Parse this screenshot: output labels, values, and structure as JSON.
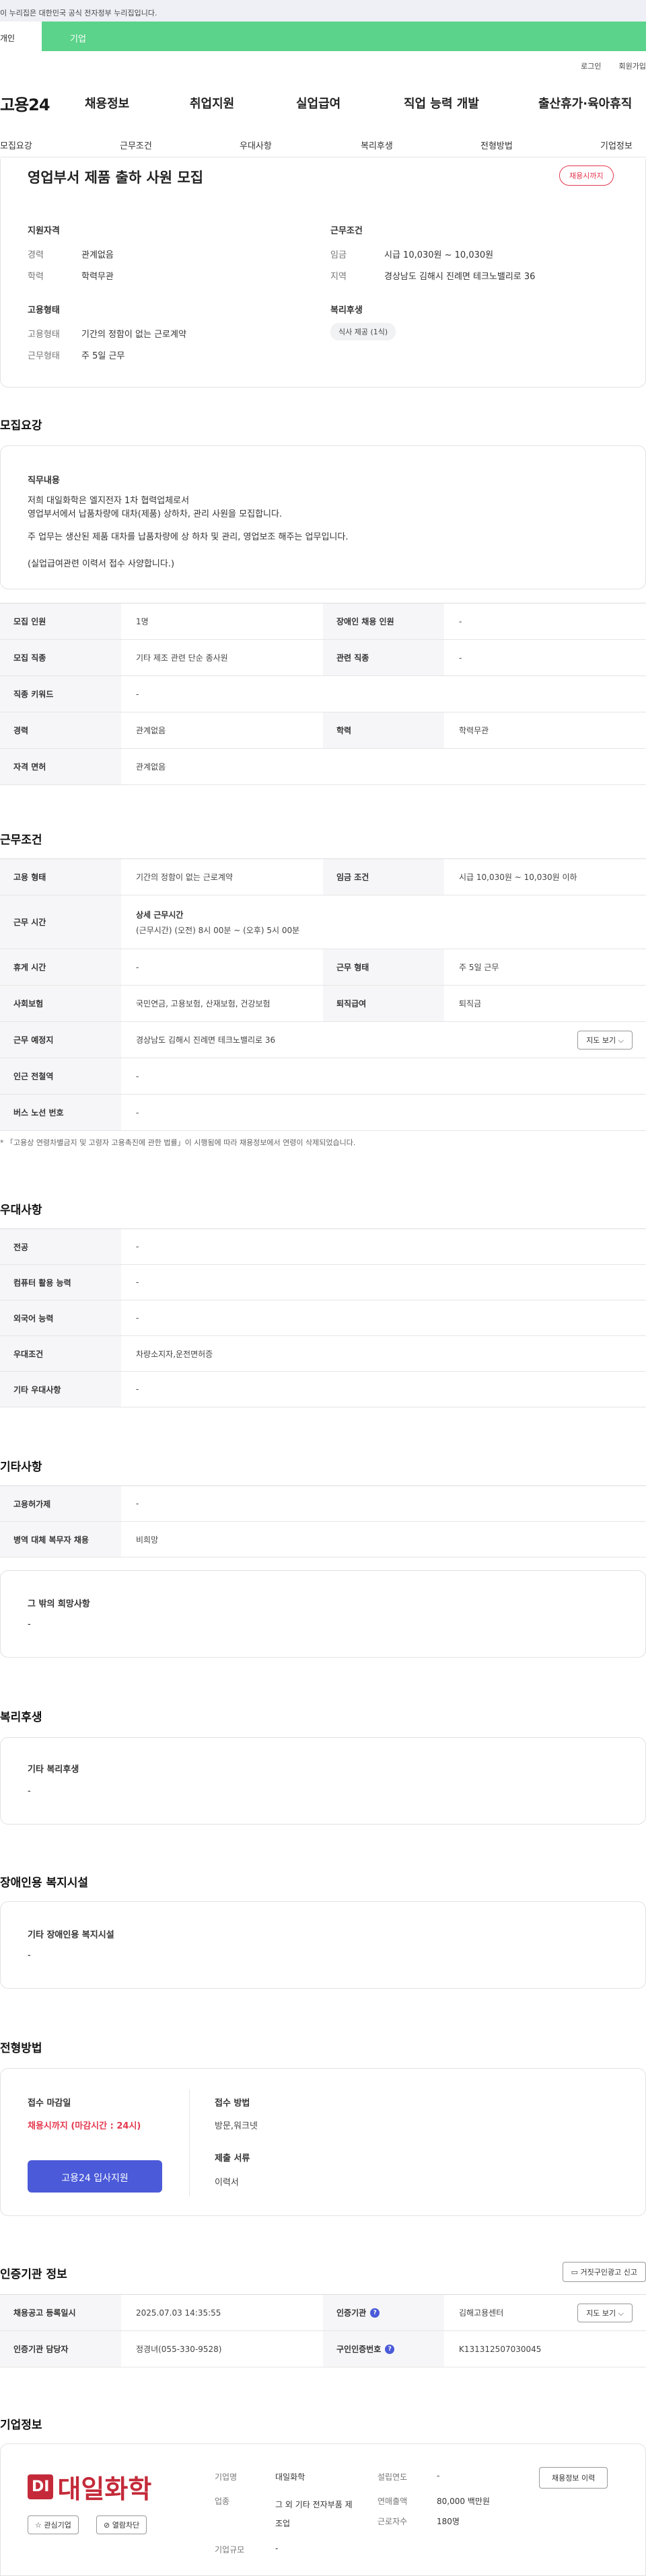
{
  "gov_banner": "이 누리집은 대한민국 공식 전자정부 누리집입니다.",
  "tabs": {
    "individual": "개인",
    "business": "기업"
  },
  "util": {
    "login": "로그인",
    "signup": "회원가입"
  },
  "gnb": {
    "logo": "고용24",
    "items": [
      "채용정보",
      "취업지원",
      "실업급여",
      "직업 능력 개발",
      "출산휴가·육아휴직"
    ]
  },
  "anchors": [
    "모집요강",
    "근무조건",
    "우대사항",
    "복리후생",
    "전형방법",
    "기업정보"
  ],
  "summary": {
    "title": "영업부서 제품 출하 사원 모집",
    "status": "채용시까지",
    "qual_title": "지원자격",
    "qual": [
      {
        "k": "경력",
        "v": "관계없음"
      },
      {
        "k": "학력",
        "v": "학력무관"
      }
    ],
    "cond_title": "근무조건",
    "cond": [
      {
        "k": "임금",
        "v": "시급 10,030원 ~ 10,030원"
      },
      {
        "k": "지역",
        "v": "경상남도 김해시 진례면 테크노밸리로 36"
      }
    ],
    "emp_title": "고용형태",
    "emp": [
      {
        "k": "고용형태",
        "v": "기간의 정함이 없는 근로계약"
      },
      {
        "k": "근무형태",
        "v": "주 5일 근무"
      }
    ],
    "welfare_title": "복리후생",
    "welfare_tag": "식사 제공 (1식)"
  },
  "recruit": {
    "heading": "모집요강",
    "job_title": "직무내용",
    "job_lines": [
      "저희 대일화학은 엘지전자 1차 협력업체로서",
      "영업부서에서 납품차량에 대차(제품) 상하차, 관리 사원을 모집합니다.",
      "주 업무는 생산된 제품 대차를 납품차량에 상 하차 및 관리, 영업보조 해주는 업무입니다.",
      "(실업급여관련 이력서 접수 사양합니다.)"
    ],
    "rows": [
      {
        "a": "모집 인원",
        "b": "1명",
        "c": "장애인 채용 인원",
        "d": "-"
      },
      {
        "a": "모집 직종",
        "b": "기타 제조 관련 단순 종사원",
        "c": "관련 직종",
        "d": "-"
      },
      {
        "a": "직종 키워드",
        "b": "-"
      },
      {
        "a": "경력",
        "b": "관계없음",
        "c": "학력",
        "d": "학력무관"
      },
      {
        "a": "자격 면허",
        "b": "관계없음"
      }
    ]
  },
  "work": {
    "heading": "근무조건",
    "r1": {
      "a": "고용 형태",
      "b": "기간의 정함이 없는 근로계약",
      "c": "임금 조건",
      "d": "시급 10,030원 ~ 10,030원 이하"
    },
    "r2": {
      "a": "근무 시간",
      "b1": "상세 근무시간",
      "b2": "(근무시간) (오전) 8시 00분 ~ (오후) 5시 00분"
    },
    "r3": {
      "a": "휴게 시간",
      "b": "-",
      "c": "근무 형태",
      "d": "주 5일 근무"
    },
    "r4": {
      "a": "사회보험",
      "b": "국민연금, 고용보험, 산재보험, 건강보험",
      "c": "퇴직급여",
      "d": "퇴직금"
    },
    "r5": {
      "a": "근무 예정지",
      "b": "경상남도 김해시 진례면 테크노밸리로 36",
      "btn": "지도 보기 ⌵"
    },
    "r6": {
      "a": "인근 전철역",
      "b": "-"
    },
    "r7": {
      "a": "버스 노선 번호",
      "b": "-"
    },
    "note": "* 「고용상 연령차별금지 및 고령자 고용촉진에 관한 법률」이 시행됨에 따라 채용정보에서 연령이 삭제되었습니다."
  },
  "pref": {
    "heading": "우대사항",
    "rows": [
      {
        "a": "전공",
        "b": "-"
      },
      {
        "a": "컴퓨터 활용 능력",
        "b": "-"
      },
      {
        "a": "외국어 능력",
        "b": "-"
      },
      {
        "a": "우대조건",
        "b": "차량소지자,운전면허증"
      },
      {
        "a": "기타 우대사항",
        "b": "-"
      }
    ]
  },
  "etc": {
    "heading": "기타사항",
    "rows": [
      {
        "a": "고용허가제",
        "b": "-"
      },
      {
        "a": "병역 대체 복무자 채용",
        "b": "비희망"
      }
    ],
    "box_title": "그 밖의 희망사항",
    "box_val": "-"
  },
  "welfare": {
    "heading": "복리후생",
    "box_title": "기타 복리후생",
    "box_val": "-"
  },
  "disab": {
    "heading": "장애인용 복지시설",
    "box_title": "기타 장애인용 복지시설",
    "box_val": "-"
  },
  "selection": {
    "heading": "전형방법",
    "deadline_title": "접수 마감일",
    "deadline": "채용시까지 (마감시간 : 24시)",
    "apply_btn": "고용24 입사지원",
    "method_title": "접수 방법",
    "method": "방문,워크넷",
    "docs_title": "제출 서류",
    "docs": "이력서"
  },
  "agency": {
    "heading": "인증기관 정보",
    "report_btn": "거짓구인광고 신고",
    "r1": {
      "a": "채용공고 등록일시",
      "b": "2025.07.03 14:35:55",
      "c": "인증기관",
      "d": "김해고용센터",
      "btn": "지도 보기 ⌵"
    },
    "r2": {
      "a": "인증기관 담당자",
      "b": "정경녀(055-330-9528)",
      "c": "구인인증번호",
      "d": "K131312507030045"
    }
  },
  "company": {
    "heading": "기업정보",
    "logo_mark": "DI",
    "logo_text": "대일화학",
    "fav_btn": "☆ 관심기업",
    "block_btn": "⊘ 열람차단",
    "name_k": "기업명",
    "name_v": "대일화학",
    "ind_k": "업종",
    "ind_v": "그 외 기타 전자부품 제조업",
    "size_k": "기업규모",
    "size_v": "-",
    "est_k": "설립연도",
    "est_v": "-",
    "rev_k": "연매출액",
    "rev_v": "80,000 백만원",
    "emp_k": "근로자수",
    "emp_v": "180명",
    "history_btn": "채용정보 이력"
  },
  "colors": {
    "accent": "#4a5ad8",
    "green": "#5bd38a",
    "red": "#e5384f"
  }
}
